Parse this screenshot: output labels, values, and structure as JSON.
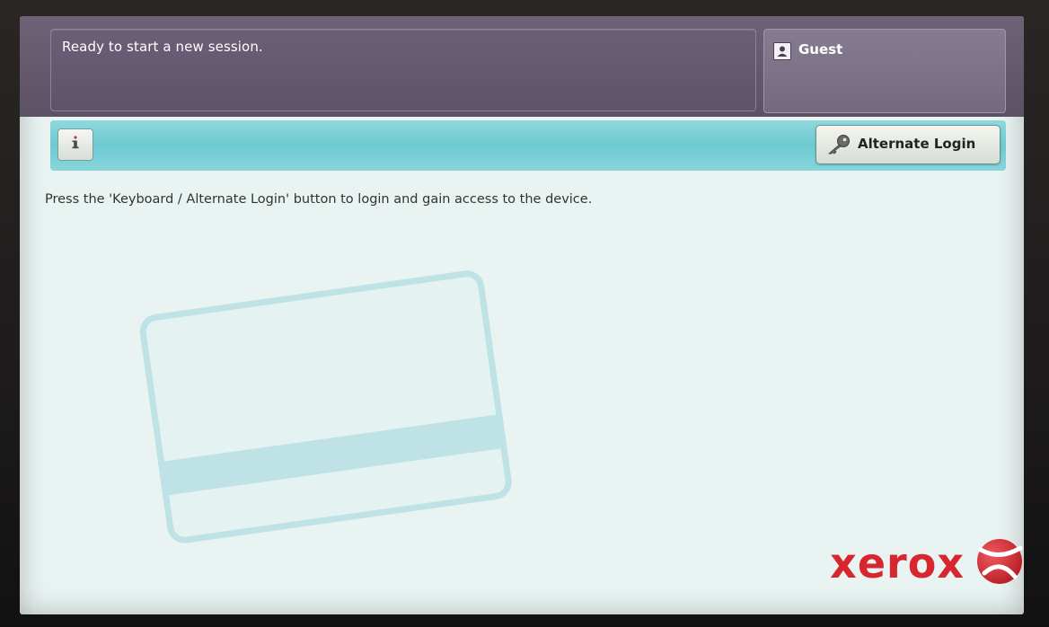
{
  "status": {
    "message": "Ready to start a new session."
  },
  "user": {
    "name": "Guest",
    "icon": "user-icon"
  },
  "toolbar": {
    "info_icon": "info-icon",
    "alternate_login_label": "Alternate Login",
    "alternate_login_icon": "key-icon"
  },
  "main": {
    "instruction": "Press the 'Keyboard / Alternate Login' button to login and gain access to the device.",
    "illustration": "card-swipe-illustration"
  },
  "branding": {
    "logo_text": "xerox",
    "logo_color": "#d8262e"
  },
  "colors": {
    "header": "#5e536a",
    "toolbar": "#6ccad0",
    "background": "#e9f3f1"
  }
}
